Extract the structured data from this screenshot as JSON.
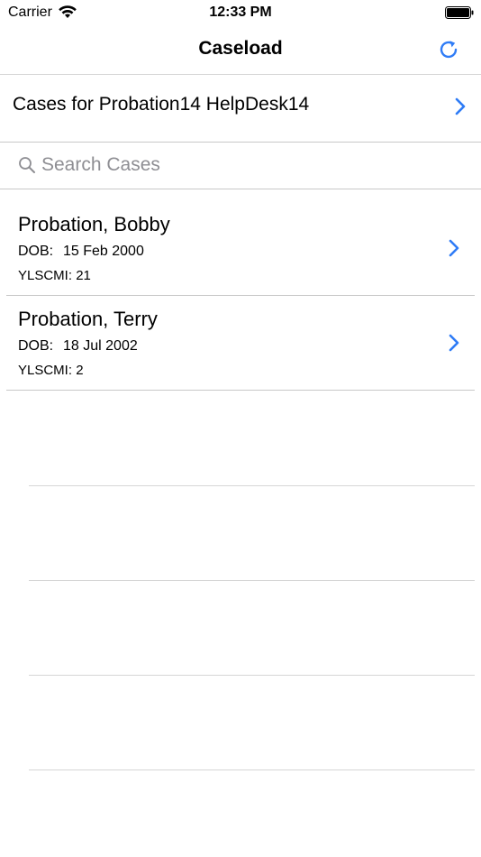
{
  "status_bar": {
    "carrier": "Carrier",
    "time": "12:33 PM"
  },
  "nav": {
    "title": "Caseload",
    "refresh_icon": "refresh-icon"
  },
  "cases_for": {
    "label": "Cases for Probation14 HelpDesk14"
  },
  "search": {
    "placeholder": "Search Cases",
    "value": ""
  },
  "cases": [
    {
      "name": "Probation, Bobby",
      "dob_label": "DOB:",
      "dob": "15 Feb 2000",
      "score_label": "YLSCMI:",
      "score": "21"
    },
    {
      "name": "Probation, Terry",
      "dob_label": "DOB:",
      "dob": "18 Jul 2002",
      "score_label": "YLSCMI:",
      "score": "2"
    }
  ],
  "colors": {
    "accent": "#2f7cf6",
    "separator": "#c8c8c8",
    "placeholder": "#8e8e93"
  }
}
